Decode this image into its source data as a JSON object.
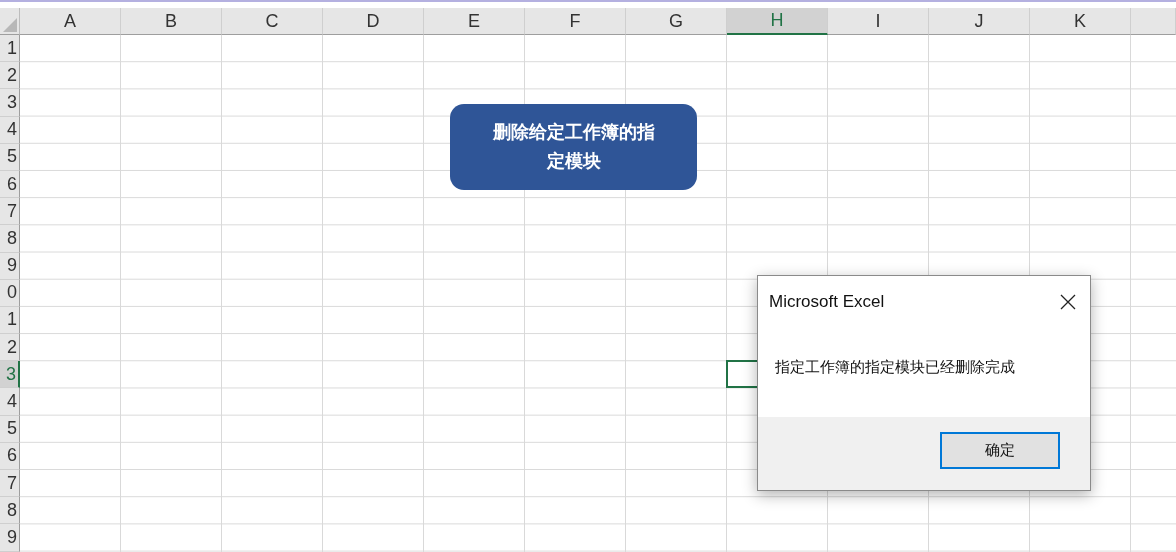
{
  "columns": [
    {
      "label": "A",
      "selected": false
    },
    {
      "label": "B",
      "selected": false
    },
    {
      "label": "C",
      "selected": false
    },
    {
      "label": "D",
      "selected": false
    },
    {
      "label": "E",
      "selected": false
    },
    {
      "label": "F",
      "selected": false
    },
    {
      "label": "G",
      "selected": false
    },
    {
      "label": "H",
      "selected": true
    },
    {
      "label": "I",
      "selected": false
    },
    {
      "label": "J",
      "selected": false
    },
    {
      "label": "K",
      "selected": false
    }
  ],
  "rows": [
    {
      "label": "1",
      "selected": false
    },
    {
      "label": "2",
      "selected": false
    },
    {
      "label": "3",
      "selected": false
    },
    {
      "label": "4",
      "selected": false
    },
    {
      "label": "5",
      "selected": false
    },
    {
      "label": "6",
      "selected": false
    },
    {
      "label": "7",
      "selected": false
    },
    {
      "label": "8",
      "selected": false
    },
    {
      "label": "9",
      "selected": false
    },
    {
      "label": "0",
      "selected": false
    },
    {
      "label": "1",
      "selected": false
    },
    {
      "label": "2",
      "selected": false
    },
    {
      "label": "3",
      "selected": true
    },
    {
      "label": "4",
      "selected": false
    },
    {
      "label": "5",
      "selected": false
    },
    {
      "label": "6",
      "selected": false
    },
    {
      "label": "7",
      "selected": false
    },
    {
      "label": "8",
      "selected": false
    },
    {
      "label": "9",
      "selected": false
    }
  ],
  "shape": {
    "text": "删除给定工作簿的指定模块"
  },
  "dialog": {
    "title": "Microsoft Excel",
    "message": "指定工作簿的指定模块已经删除完成",
    "button": "确定"
  }
}
